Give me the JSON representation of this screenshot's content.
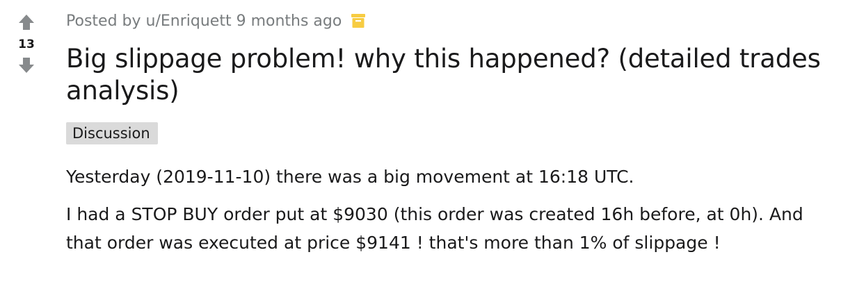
{
  "vote": {
    "score": "13"
  },
  "meta": {
    "prefix": "Posted by",
    "user": "u/Enriquett",
    "time": "9 months ago",
    "archive_icon": "archive-box-icon",
    "archive_color": "#f7cc42"
  },
  "post": {
    "title": "Big slippage problem! why this happened? (detailed trades analysis)",
    "flair": "Discussion",
    "paragraphs": [
      "Yesterday (2019-11-10) there was a big movement at 16:18 UTC.",
      "I had a STOP BUY order put at $9030 (this order was created 16h before, at 0h). And that order was executed at price $9141 ! that's more than 1% of slippage !"
    ]
  },
  "colors": {
    "text": "#1a1a1b",
    "meta": "#787c7e",
    "arrow": "#878a8c",
    "flair_bg": "#dadada"
  }
}
